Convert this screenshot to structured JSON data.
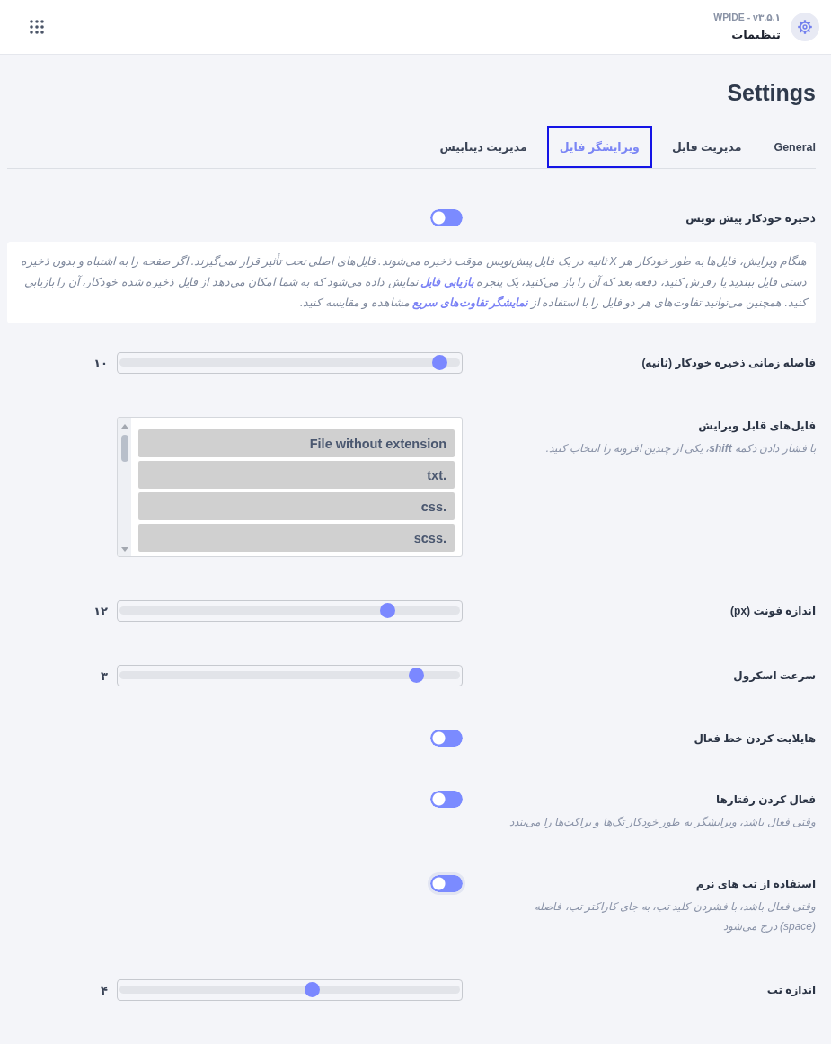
{
  "header": {
    "version": "WPIDE - v۳.۵.۱",
    "title": "تنظیمات"
  },
  "page_title": "Settings",
  "tabs": [
    {
      "label": "General",
      "selected": false
    },
    {
      "label": "مدیریت فایل",
      "selected": false
    },
    {
      "label": "ویرایشگر فایل",
      "selected": true
    },
    {
      "label": "مدیریت دیتابیس",
      "selected": false
    }
  ],
  "settings": [
    {
      "kind": "toggle",
      "label": "ذخیره خودکار پیش نویس",
      "on": true,
      "focused": false,
      "info": [
        {
          "kind": "text",
          "text": "هنگام ویرایش، فایل‌ها به طور خودکار هر X ثانیه در یک فایل پیش‌نویس موقت ذخیره می‌شوند. فایل‌های اصلی تحت تأثیر قرار نمی‌گیرند. اگر صفحه را به اشتباه و بدون ذخیره دستی فایل ببندید یا رفرش کنید، دفعه بعد که آن را باز می‌کنید، یک پنجره "
        },
        {
          "kind": "link",
          "text": "بازیابی فایل"
        },
        {
          "kind": "text",
          "text": " نمایش داده می‌شود که به شما امکان می‌دهد از فایل ذخیره شده خودکار، آن را بازیابی کنید. همچنین می‌توانید تفاوت‌های هر دو فایل را با استفاده از "
        },
        {
          "kind": "link",
          "text": "نمایشگر تفاوت‌های سریع"
        },
        {
          "kind": "text",
          "text": " مشاهده و مقایسه کنید."
        }
      ]
    },
    {
      "kind": "slider",
      "label": "فاصله زمانی ذخیره خودکار (ثانیه)",
      "level": 0.96,
      "reading": "۱۰"
    },
    {
      "kind": "multiselect",
      "label": "فایل‌های قابل ویرایش",
      "description": "با فشار دادن دکمه **shift**، یکی از چندین افزونه را انتخاب کنید.",
      "options": [
        {
          "label": "File without extension",
          "selected": true
        },
        {
          "label": "txt.",
          "selected": true
        },
        {
          "label": "css.",
          "selected": true
        },
        {
          "label": "scss.",
          "selected": true
        }
      ]
    },
    {
      "kind": "slider",
      "label": "اندازه فونت (px)",
      "level": 0.8,
      "reading": "۱۲"
    },
    {
      "kind": "slider",
      "label": "سرعت اسکرول",
      "level": 0.89,
      "reading": "۳"
    },
    {
      "kind": "toggle",
      "label": "هایلایت کردن خط فعال",
      "on": true,
      "focused": false
    },
    {
      "kind": "toggle",
      "label": "فعال کردن رفتارها",
      "on": true,
      "focused": false,
      "description": "وقتی فعال باشد، ویرایشگر به طور خودکار تگ‌ها و براکت‌ها را می‌بندد"
    },
    {
      "kind": "toggle",
      "label": "استفاده از تب های نرم",
      "on": true,
      "focused": true,
      "description": "وقتی فعال باشد، با فشردن کلید تب، به جای کاراکتر تب، فاصله (space) درج می‌شود"
    },
    {
      "kind": "slider",
      "label": "اندازه تب",
      "level": 0.57,
      "reading": "۴"
    }
  ]
}
